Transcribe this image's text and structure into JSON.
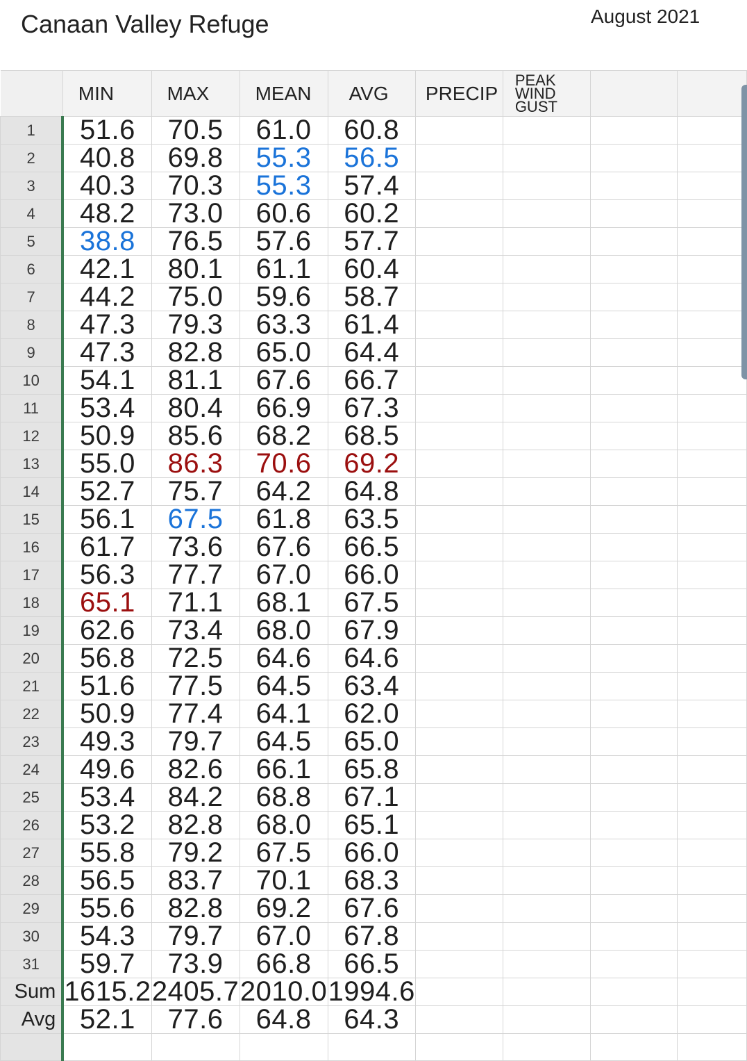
{
  "title": "Canaan Valley Refuge",
  "month": "August 2021",
  "columns": [
    "MIN",
    "MAX",
    "MEAN",
    "AVG",
    "PRECIP",
    "PEAK\nWIND\nGUST",
    "",
    ""
  ],
  "rows": [
    {
      "n": "1",
      "min": "51.6",
      "max": "70.5",
      "mean": "61.0",
      "avg": "60.8"
    },
    {
      "n": "2",
      "min": "40.8",
      "max": "69.8",
      "mean": "55.3",
      "avg": "56.5",
      "mean_c": "blue",
      "avg_c": "blue"
    },
    {
      "n": "3",
      "min": "40.3",
      "max": "70.3",
      "mean": "55.3",
      "avg": "57.4",
      "mean_c": "blue"
    },
    {
      "n": "4",
      "min": "48.2",
      "max": "73.0",
      "mean": "60.6",
      "avg": "60.2"
    },
    {
      "n": "5",
      "min": "38.8",
      "max": "76.5",
      "mean": "57.6",
      "avg": "57.7",
      "min_c": "blue"
    },
    {
      "n": "6",
      "min": "42.1",
      "max": "80.1",
      "mean": "61.1",
      "avg": "60.4"
    },
    {
      "n": "7",
      "min": "44.2",
      "max": "75.0",
      "mean": "59.6",
      "avg": "58.7"
    },
    {
      "n": "8",
      "min": "47.3",
      "max": "79.3",
      "mean": "63.3",
      "avg": "61.4"
    },
    {
      "n": "9",
      "min": "47.3",
      "max": "82.8",
      "mean": "65.0",
      "avg": "64.4"
    },
    {
      "n": "10",
      "min": "54.1",
      "max": "81.1",
      "mean": "67.6",
      "avg": "66.7"
    },
    {
      "n": "11",
      "min": "53.4",
      "max": "80.4",
      "mean": "66.9",
      "avg": "67.3"
    },
    {
      "n": "12",
      "min": "50.9",
      "max": "85.6",
      "mean": "68.2",
      "avg": "68.5"
    },
    {
      "n": "13",
      "min": "55.0",
      "max": "86.3",
      "mean": "70.6",
      "avg": "69.2",
      "max_c": "red",
      "mean_c": "red",
      "avg_c": "red"
    },
    {
      "n": "14",
      "min": "52.7",
      "max": "75.7",
      "mean": "64.2",
      "avg": "64.8"
    },
    {
      "n": "15",
      "min": "56.1",
      "max": "67.5",
      "mean": "61.8",
      "avg": "63.5",
      "max_c": "blue"
    },
    {
      "n": "16",
      "min": "61.7",
      "max": "73.6",
      "mean": "67.6",
      "avg": "66.5"
    },
    {
      "n": "17",
      "min": "56.3",
      "max": "77.7",
      "mean": "67.0",
      "avg": "66.0"
    },
    {
      "n": "18",
      "min": "65.1",
      "max": "71.1",
      "mean": "68.1",
      "avg": "67.5",
      "min_c": "red"
    },
    {
      "n": "19",
      "min": "62.6",
      "max": "73.4",
      "mean": "68.0",
      "avg": "67.9"
    },
    {
      "n": "20",
      "min": "56.8",
      "max": "72.5",
      "mean": "64.6",
      "avg": "64.6"
    },
    {
      "n": "21",
      "min": "51.6",
      "max": "77.5",
      "mean": "64.5",
      "avg": "63.4"
    },
    {
      "n": "22",
      "min": "50.9",
      "max": "77.4",
      "mean": "64.1",
      "avg": "62.0"
    },
    {
      "n": "23",
      "min": "49.3",
      "max": "79.7",
      "mean": "64.5",
      "avg": "65.0"
    },
    {
      "n": "24",
      "min": "49.6",
      "max": "82.6",
      "mean": "66.1",
      "avg": "65.8"
    },
    {
      "n": "25",
      "min": "53.4",
      "max": "84.2",
      "mean": "68.8",
      "avg": "67.1"
    },
    {
      "n": "26",
      "min": "53.2",
      "max": "82.8",
      "mean": "68.0",
      "avg": "65.1"
    },
    {
      "n": "27",
      "min": "55.8",
      "max": "79.2",
      "mean": "67.5",
      "avg": "66.0"
    },
    {
      "n": "28",
      "min": "56.5",
      "max": "83.7",
      "mean": "70.1",
      "avg": "68.3"
    },
    {
      "n": "29",
      "min": "55.6",
      "max": "82.8",
      "mean": "69.2",
      "avg": "67.6"
    },
    {
      "n": "30",
      "min": "54.3",
      "max": "79.7",
      "mean": "67.0",
      "avg": "67.8"
    },
    {
      "n": "31",
      "min": "59.7",
      "max": "73.9",
      "mean": "66.8",
      "avg": "66.5"
    },
    {
      "n": "Sum",
      "min": "1615.2",
      "max": "2405.7",
      "mean": "2010.0",
      "avg": "1994.6",
      "label": true
    },
    {
      "n": "Avg",
      "min": "52.1",
      "max": "77.6",
      "mean": "64.8",
      "avg": "64.3",
      "label": true
    }
  ],
  "colors": {
    "low_highlight": "#1a73d9",
    "high_highlight": "#9b0f0f",
    "frozen_divider": "#3a7a50"
  }
}
